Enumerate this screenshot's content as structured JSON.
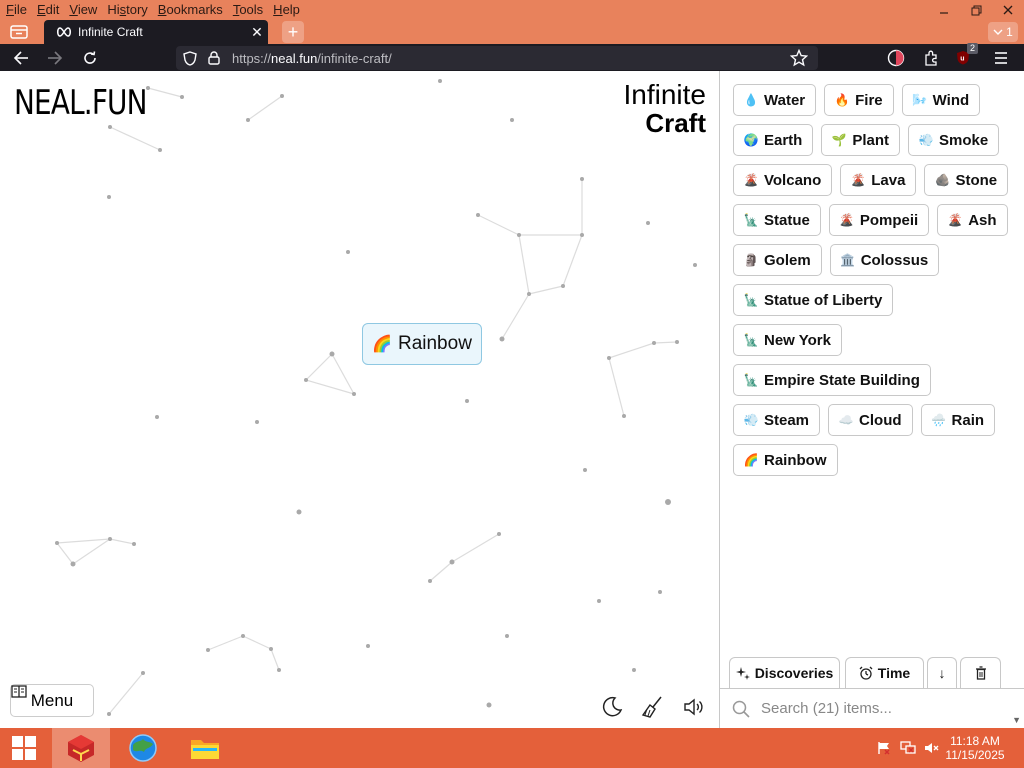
{
  "menubar": {
    "items": [
      {
        "label": "File",
        "u": "F",
        "rest": "ile"
      },
      {
        "label": "Edit",
        "u": "E",
        "rest": "dit"
      },
      {
        "label": "View",
        "u": "V",
        "rest": "iew"
      },
      {
        "label": "History",
        "u": "s",
        "pre": "Hi",
        "rest": "tory"
      },
      {
        "label": "Bookmarks",
        "u": "B",
        "rest": "ookmarks"
      },
      {
        "label": "Tools",
        "u": "T",
        "rest": "ools"
      },
      {
        "label": "Help",
        "u": "H",
        "rest": "elp"
      }
    ]
  },
  "tab": {
    "title": "Infinite Craft",
    "close": "✕"
  },
  "tabs_count": "1",
  "url": {
    "scheme": "https://",
    "host": "neal.fun",
    "path": "/infinite-craft/"
  },
  "extension_badge": "2",
  "page": {
    "logo": "NEAL.FUN",
    "title_line1": "Infinite",
    "title_line2": "Craft",
    "canvas_item": {
      "emoji": "🌈",
      "label": "Rainbow"
    },
    "menu_label": "Menu"
  },
  "sidebar": {
    "rows": [
      [
        {
          "emoji": "💧",
          "label": "Water"
        },
        {
          "emoji": "🔥",
          "label": "Fire"
        },
        {
          "emoji": "🌬️",
          "label": "Wind"
        }
      ],
      [
        {
          "emoji": "🌍",
          "label": "Earth"
        },
        {
          "emoji": "🌱",
          "label": "Plant"
        },
        {
          "emoji": "💨",
          "label": "Smoke"
        }
      ],
      [
        {
          "emoji": "🌋",
          "label": "Volcano"
        },
        {
          "emoji": "🌋",
          "label": "Lava"
        },
        {
          "emoji": "🪨",
          "label": "Stone"
        }
      ],
      [
        {
          "emoji": "🗽",
          "label": "Statue"
        },
        {
          "emoji": "🌋",
          "label": "Pompeii"
        },
        {
          "emoji": "🌋",
          "label": "Ash"
        }
      ],
      [
        {
          "emoji": "🗿",
          "label": "Golem"
        },
        {
          "emoji": "🏛️",
          "label": "Colossus"
        }
      ],
      [
        {
          "emoji": "🗽",
          "label": "Statue of Liberty"
        }
      ],
      [
        {
          "emoji": "🗽",
          "label": "New York"
        }
      ],
      [
        {
          "emoji": "🗽",
          "label": "Empire State Building"
        }
      ],
      [
        {
          "emoji": "💨",
          "label": "Steam"
        },
        {
          "emoji": "☁️",
          "label": "Cloud"
        },
        {
          "emoji": "🌧️",
          "label": "Rain"
        }
      ],
      [
        {
          "emoji": "🌈",
          "label": "Rainbow"
        }
      ]
    ],
    "discoveries_label": "Discoveries",
    "time_label": "Time",
    "sort_arrow": "↓",
    "search_placeholder": "Search (21) items..."
  },
  "taskbar": {
    "time": "11:18 AM",
    "date": "11/15/2025"
  },
  "colors": {
    "browser_accent": "#e8825c",
    "taskbar": "#e4603a",
    "dark_chrome": "#1c1b22",
    "canvas_item_bg": "#eaf6fc"
  }
}
